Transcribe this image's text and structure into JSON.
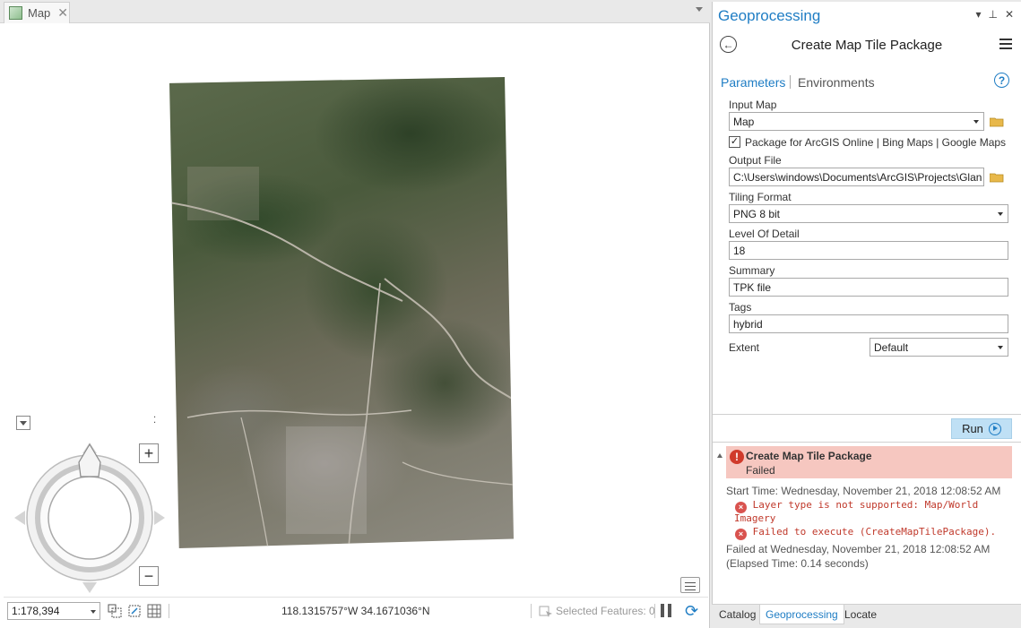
{
  "map_tab": {
    "label": "Map",
    "close": "✕"
  },
  "status": {
    "scale": "1:178,394",
    "coordinates": "118.1315757°W 34.1671036°N",
    "selected_features": "Selected Features: 0"
  },
  "icons": {
    "pane_dropdown": "chevron-down-icon",
    "pane_pin": "pin-icon",
    "pane_close": "close-icon",
    "back": "back-arrow-icon",
    "menu": "hamburger-icon",
    "help": "help-icon",
    "folder": "folder-icon",
    "run": "play-icon",
    "error": "error-icon"
  },
  "geoprocessing": {
    "pane_title": "Geoprocessing",
    "pane_pin": "⊥",
    "pane_close": "✕",
    "tool_title": "Create Map Tile Package",
    "tabs": {
      "parameters": "Parameters",
      "environments": "Environments"
    },
    "help_glyph": "?",
    "params": {
      "input_map_label": "Input Map",
      "input_map_value": "Map",
      "package_checkbox_label": "Package for ArcGIS Online | Bing Maps | Google Maps",
      "package_checked": "✓",
      "output_file_label": "Output File",
      "output_file_value": "C:\\Users\\windows\\Documents\\ArcGIS\\Projects\\Glan",
      "tiling_format_label": "Tiling Format",
      "tiling_format_value": "PNG 8 bit",
      "level_of_detail_label": "Level Of Detail",
      "level_of_detail_value": "18",
      "summary_label": "Summary",
      "summary_value": "TPK file",
      "tags_label": "Tags",
      "tags_value": "hybrid",
      "extent_label": "Extent",
      "extent_value": "Default"
    },
    "run_label": "Run",
    "messages": {
      "banner_title": "Create Map Tile Package",
      "banner_status": "Failed",
      "start_time": "Start Time: Wednesday, November 21, 2018 12:08:52 AM",
      "error1_line1": "Layer type is not supported: Map/World",
      "error1_line2": "Imagery",
      "error2": "Failed to execute (CreateMapTilePackage).",
      "failed_at": "Failed at Wednesday, November 21, 2018 12:08:52 AM",
      "elapsed": "(Elapsed Time: 0.14 seconds)"
    }
  },
  "bottom_tabs": [
    "Catalog",
    "Geoprocessing",
    "Locate"
  ],
  "colors": {
    "accent": "#1f7dc4",
    "error_banner": "#f6c7c0",
    "error_text": "#c0392b",
    "run_button": "#bfe0f5"
  }
}
